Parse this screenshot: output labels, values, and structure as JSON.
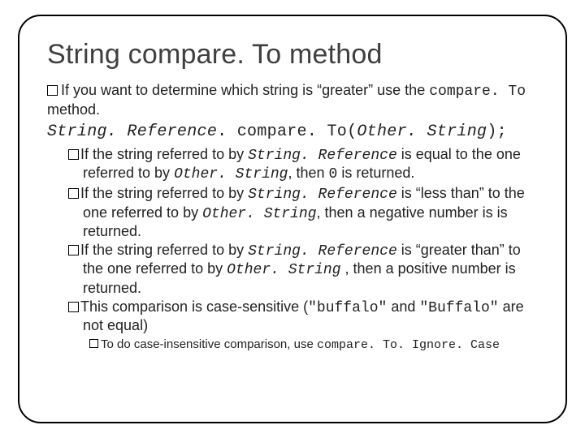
{
  "title": "String compare. To method",
  "b1": {
    "t1": "If you want to determine which string is “greater” use the ",
    "c1": "compare. To",
    "t2": " method."
  },
  "code": {
    "s1": "String. Reference",
    "dot1": ". ",
    "s2": "compare. To(",
    "s3": "Other. String",
    "s4": ");"
  },
  "sr": "String. Reference",
  "os": "Other. String",
  "b2": {
    "t1": "If the string referred to by ",
    "t2": " is equal to the one referred to by ",
    "t3": ", then ",
    "zero": "0",
    "t4": " is returned."
  },
  "b3": {
    "t1": "If the string referred to by ",
    "t2": " is “less than” to the one referred to by ",
    "t3": ", then a negative number is is returned."
  },
  "b4": {
    "t1": "If the string referred to by ",
    "t2": " is “greater than” to the one referred to by ",
    "t3": " , then a positive number is returned."
  },
  "b5": {
    "t1": "This comparison is case-sensitive (",
    "q1": "\"buffalo\"",
    "t2": " and ",
    "q2": "\"Buffalo\"",
    "t3": " are not equal)"
  },
  "b6": {
    "t1": "To do case-insensitive comparison, use ",
    "c1": "compare. To. Ignore. Case"
  }
}
